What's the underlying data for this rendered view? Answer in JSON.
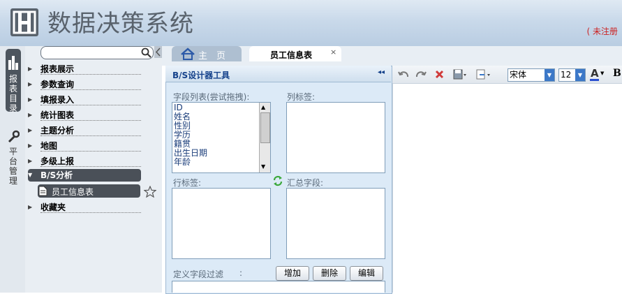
{
  "header": {
    "app_title": "数据决策系统",
    "unregistered": "( 未注册"
  },
  "left_tabs": {
    "reports": "报表目录",
    "platform": "平台管理"
  },
  "tree": {
    "items": [
      {
        "label": "报表展示",
        "expanded": false
      },
      {
        "label": "参数查询",
        "expanded": false
      },
      {
        "label": "填报录入",
        "expanded": false
      },
      {
        "label": "统计图表",
        "expanded": false
      },
      {
        "label": "主题分析",
        "expanded": false
      },
      {
        "label": "地图",
        "expanded": false
      },
      {
        "label": "多级上报",
        "expanded": false
      },
      {
        "label": "B/S分析",
        "expanded": true
      },
      {
        "label": "收藏夹",
        "expanded": false
      }
    ],
    "leaf": {
      "label": "员工信息表"
    }
  },
  "tabs": {
    "home": "主　页",
    "employee": "员工信息表"
  },
  "designer": {
    "title": "B/S设计器工具",
    "field_list_label": "字段列表(尝试拖拽):",
    "fields": [
      "ID",
      "姓名",
      "性别",
      "学历",
      "籍贯",
      "出生日期",
      "年龄"
    ],
    "column_label": "列标签:",
    "row_label": "行标签:",
    "summary_label": "汇总字段:",
    "filter_label": "定义字段过滤",
    "filter_colon": ":",
    "buttons": {
      "add": "增加",
      "delete": "删除",
      "edit": "编辑"
    }
  },
  "toolbar": {
    "font_family": "宋体",
    "font_size": "12",
    "font_color_letter": "A",
    "bold_letter": "B"
  },
  "colors": {
    "accent": "#4a5058",
    "unregistered": "#cc2222",
    "panel": "#dceaf7"
  }
}
